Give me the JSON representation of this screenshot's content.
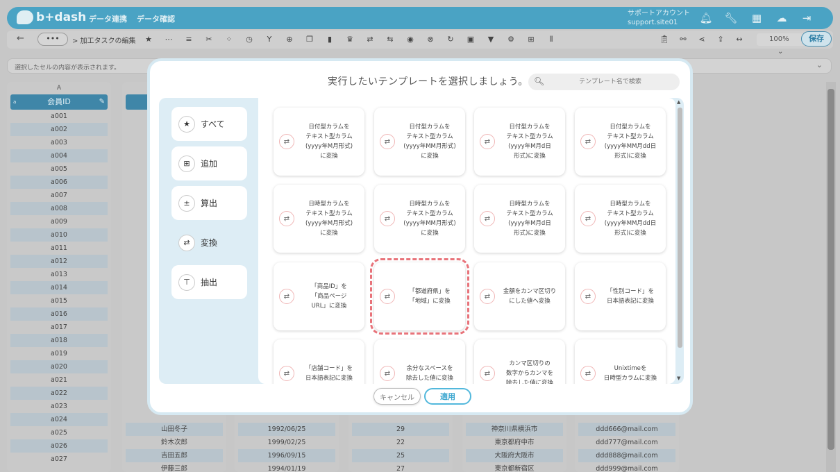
{
  "header": {
    "logo_text": "b+dash",
    "nav": [
      "データ連携",
      "データ確認"
    ],
    "account_line1": "サポートアカウント",
    "account_line2": "support.site01"
  },
  "toolbar": {
    "back_label": "←",
    "more_label": "•••",
    "breadcrumb": "> 加工タスクの編集",
    "zoom": "100%",
    "save_label": "保存"
  },
  "cellbar": {
    "placeholder": "選択したセルの内容が表示されます。"
  },
  "grid": {
    "col_a_letter": "A",
    "col_a_header": "会員ID",
    "col_a_cells": [
      "a001",
      "a002",
      "a003",
      "a004",
      "a005",
      "a006",
      "a007",
      "a008",
      "a009",
      "a010",
      "a011",
      "a012",
      "a013",
      "a014",
      "a015",
      "a016",
      "a017",
      "a018",
      "a019",
      "a020",
      "a021",
      "a022",
      "a023",
      "a024",
      "a025",
      "a026",
      "a027"
    ],
    "bottom_rows": [
      {
        "name": "山田冬子",
        "date": "1992/06/25",
        "age": "29",
        "city": "神奈川県横浜市",
        "mail": "ddd666@mail.com"
      },
      {
        "name": "鈴木次郎",
        "date": "1999/02/25",
        "age": "22",
        "city": "東京都府中市",
        "mail": "ddd777@mail.com"
      },
      {
        "name": "吉田五郎",
        "date": "1996/09/15",
        "age": "25",
        "city": "大阪府大阪市",
        "mail": "ddd888@mail.com"
      },
      {
        "name": "伊藤三郎",
        "date": "1994/01/19",
        "age": "27",
        "city": "東京都新宿区",
        "mail": "ddd999@mail.com"
      }
    ]
  },
  "modal": {
    "title": "実行したいテンプレートを選択しましょう。",
    "search_placeholder": "テンプレート名で検索",
    "categories": [
      {
        "label": "すべて",
        "icon": "★"
      },
      {
        "label": "追加",
        "icon": "⊞"
      },
      {
        "label": "算出",
        "icon": "±"
      },
      {
        "label": "変換",
        "icon": "⇄"
      },
      {
        "label": "抽出",
        "icon": "⊤"
      }
    ],
    "cards": [
      "日付型カラムを\nテキスト型カラム\n(yyyy年M月形式)\nに変換",
      "日付型カラムを\nテキスト型カラム\n(yyyy年MM月形式)\nに変換",
      "日付型カラムを\nテキスト型カラム\n(yyyy年M月d日\n形式)に変換",
      "日付型カラムを\nテキスト型カラム\n(yyyy年MM月dd日\n形式)に変換",
      "日時型カラムを\nテキスト型カラム\n(yyyy年M月形式)\nに変換",
      "日時型カラムを\nテキスト型カラム\n(yyyy年MM月形式)\nに変換",
      "日時型カラムを\nテキスト型カラム\n(yyyy年M月d日\n形式)に変換",
      "日時型カラムを\nテキスト型カラム\n(yyyy年MM月dd日\n形式)に変換",
      "「商品ID」を\n「商品ページ\nURL」に変換",
      "「都道府県」を\n「地域」に変換",
      "金額をカンマ区切り\nにした値へ変換",
      "「性別コード」を\n日本語表記に変換",
      "「店舗コード」を\n日本語表記に変換",
      "余分なスペースを\n除去した値に変換",
      "カンマ区切りの\n数字からカンマを\n除去した値に変換",
      "Unixtimeを\n日時型カラムに変換"
    ],
    "cancel_label": "キャンセル",
    "apply_label": "適用"
  }
}
